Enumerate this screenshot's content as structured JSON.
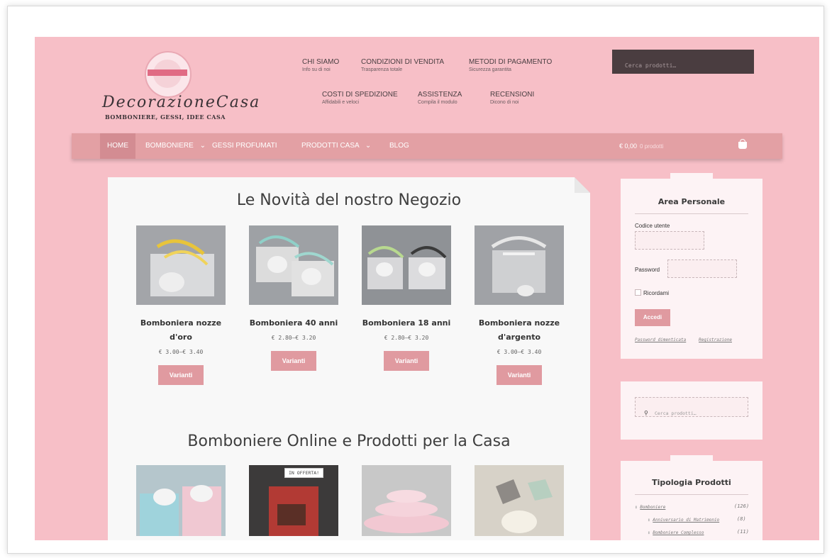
{
  "brand": {
    "title": "DecorazioneCasa",
    "subtitle": "BOMBONIERE, GESSI, IDEE CASA"
  },
  "top_links": [
    {
      "title": "CHI SIAMO",
      "sub": "Info su di noi"
    },
    {
      "title": "CONDIZIONI DI VENDITA",
      "sub": "Trasparenza totale"
    },
    {
      "title": "METODI DI PAGAMENTO",
      "sub": "Sicurezza garantita"
    },
    {
      "title": "COSTI DI SPEDIZIONE",
      "sub": "Affidabili e veloci"
    },
    {
      "title": "ASSISTENZA",
      "sub": "Compila il modulo"
    },
    {
      "title": "RECENSIONI",
      "sub": "Dicono di noi"
    }
  ],
  "search": {
    "placeholder": "Cerca prodotti…"
  },
  "nav": {
    "items": [
      "HOME",
      "BOMBONIERE",
      "GESSI PROFUMATI",
      "PRODOTTI CASA",
      "BLOG"
    ],
    "dropdown_glyph": "⌄"
  },
  "cart": {
    "total": "€ 0,00",
    "count": "0 prodotti"
  },
  "main": {
    "section1_title": "Le Novità del nostro Negozio",
    "section2_title": "Bomboniere Online e Prodotti per la Casa",
    "products": [
      {
        "name": "Bomboniera nozze d'oro",
        "price": "€ 3.00–€ 3.40",
        "button": "Varianti"
      },
      {
        "name": "Bomboniera 40 anni",
        "price": "€ 2.80–€ 3.20",
        "button": "Varianti"
      },
      {
        "name": "Bomboniera 18 anni",
        "price": "€ 2.80–€ 3.20",
        "button": "Varianti"
      },
      {
        "name": "Bomboniera nozze d'argento",
        "price": "€ 3.00–€ 3.40",
        "button": "Varianti"
      }
    ],
    "offer_badge": "IN OFFERTA!"
  },
  "sidebar": {
    "login": {
      "title": "Area Personale",
      "username_label": "Codice utente",
      "password_label": "Password",
      "remember_label": "Ricordami",
      "submit": "Accedi",
      "lost_password": "Password dimenticata",
      "register": "Registrazione"
    },
    "search_placeholder": "Cerca prodotti…",
    "categories": {
      "title": "Tipologia Prodotti",
      "items": [
        {
          "label": "Bomboniere",
          "count": "(126)"
        },
        {
          "label": "Anniversario di Matrimonio",
          "count": "(8)"
        },
        {
          "label": "Bomboniere Complesso",
          "count": "(11)"
        }
      ]
    }
  },
  "colors": {
    "page_bg": "#f7bfc7",
    "nav_bg": "#e3a0a4",
    "button": "#e09aa0",
    "search_dark": "#4a3d40"
  }
}
